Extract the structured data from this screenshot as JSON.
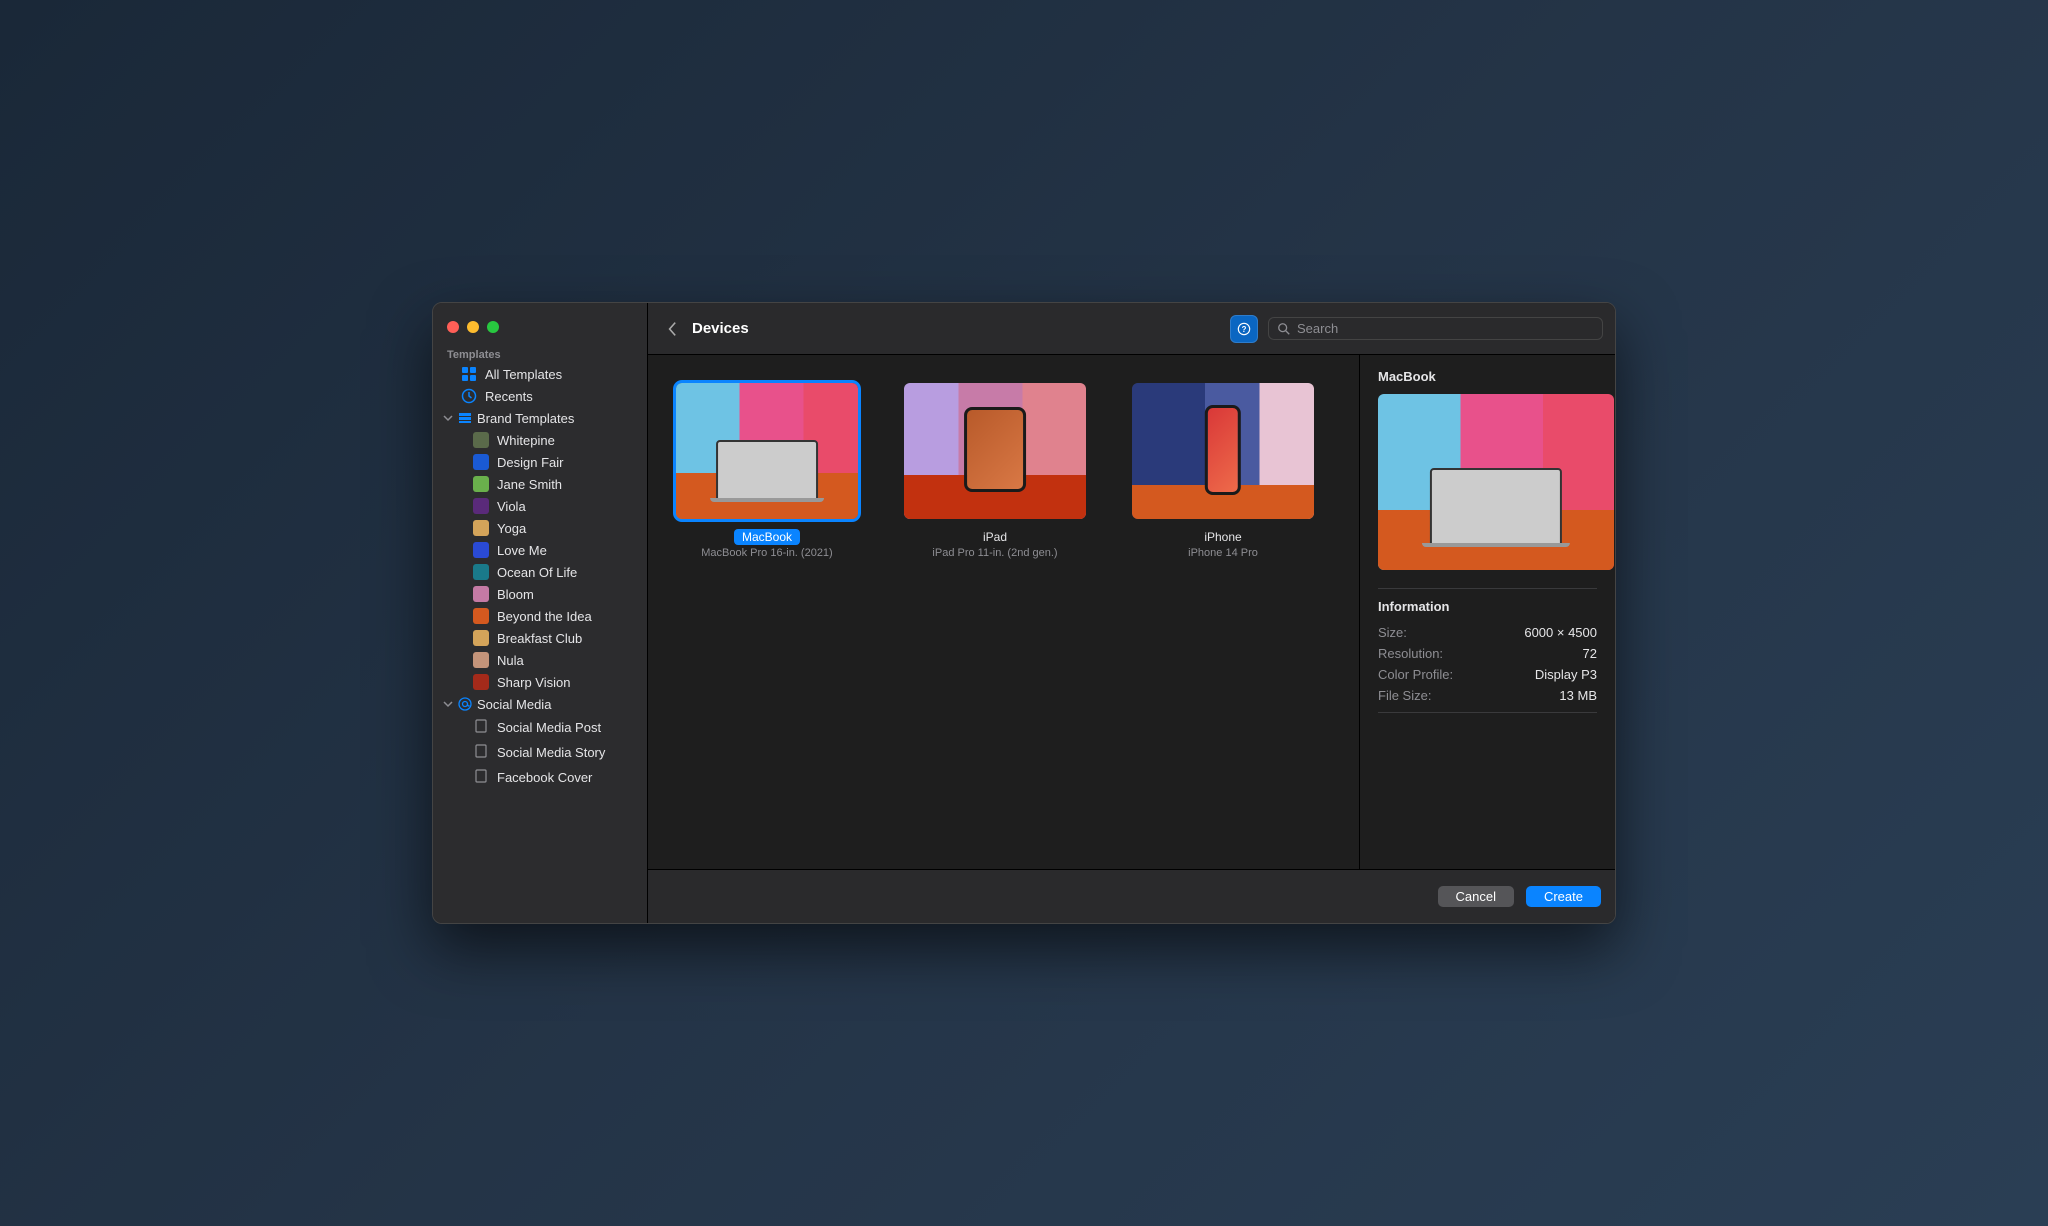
{
  "window": {
    "title": "Devices"
  },
  "sidebar": {
    "section_label": "Templates",
    "top": [
      {
        "label": "All Templates",
        "icon": "grid-icon"
      },
      {
        "label": "Recents",
        "icon": "clock-icon"
      }
    ],
    "groups": [
      {
        "label": "Brand Templates",
        "icon": "stack-icon",
        "items": [
          {
            "label": "Whitepine"
          },
          {
            "label": "Design Fair"
          },
          {
            "label": "Jane Smith"
          },
          {
            "label": "Viola"
          },
          {
            "label": "Yoga"
          },
          {
            "label": "Love Me"
          },
          {
            "label": "Ocean Of Life"
          },
          {
            "label": "Bloom"
          },
          {
            "label": "Beyond the Idea"
          },
          {
            "label": "Breakfast Club"
          },
          {
            "label": "Nula"
          },
          {
            "label": "Sharp Vision"
          }
        ]
      },
      {
        "label": "Social Media",
        "icon": "at-icon",
        "items": [
          {
            "label": "Social Media Post"
          },
          {
            "label": "Social Media Story"
          },
          {
            "label": "Facebook Cover"
          }
        ]
      }
    ]
  },
  "search": {
    "placeholder": "Search"
  },
  "templates": [
    {
      "name": "MacBook",
      "subtitle": "MacBook Pro 16-in. (2021)",
      "selected": true,
      "art": "macbook"
    },
    {
      "name": "iPad",
      "subtitle": "iPad Pro 11-in. (2nd gen.)",
      "selected": false,
      "art": "ipad"
    },
    {
      "name": "iPhone",
      "subtitle": "iPhone 14 Pro",
      "selected": false,
      "art": "iphone"
    }
  ],
  "info": {
    "title": "MacBook",
    "heading": "Information",
    "rows": [
      {
        "k": "Size:",
        "v": "6000 × 4500"
      },
      {
        "k": "Resolution:",
        "v": "72"
      },
      {
        "k": "Color Profile:",
        "v": "Display P3"
      },
      {
        "k": "File Size:",
        "v": "13 MB"
      }
    ]
  },
  "footer": {
    "cancel": "Cancel",
    "create": "Create"
  },
  "brand_thumb_colors": [
    "#5a6a4a",
    "#1a5ad4",
    "#6ab04c",
    "#5a2a7a",
    "#d4a45a",
    "#2a4ad4",
    "#1a7a8a",
    "#c47aa4",
    "#d4591f",
    "#d4a45a",
    "#c4947a",
    "#a42a1a"
  ]
}
